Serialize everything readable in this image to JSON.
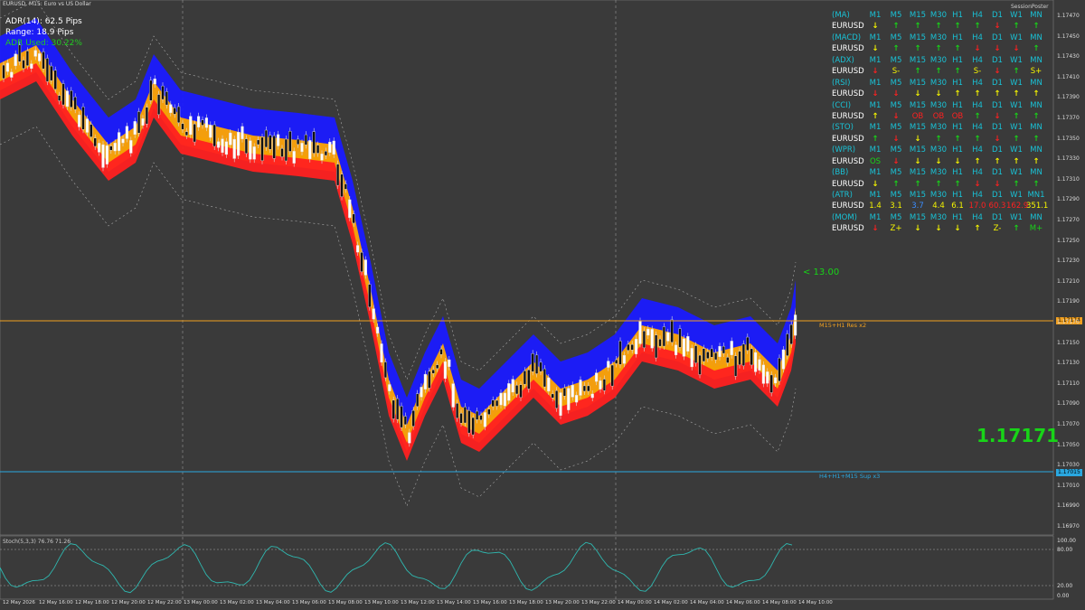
{
  "symbol_bar": "EURUSD, M15: Euro vs US Dollar",
  "session": "SessionPoster",
  "info": {
    "adr": "ADR(14): 62.5 Pips",
    "range": "Range: 18.9 Pips",
    "used": "ADR Used: 30.22%"
  },
  "table": [
    {
      "type": "hdr",
      "label": "(MA)",
      "cells": [
        "M1",
        "M5",
        "M15",
        "M30",
        "H1",
        "H4",
        "D1",
        "W1",
        "MN"
      ]
    },
    {
      "type": "val",
      "label": "EURUSD",
      "cells": [
        [
          "↓",
          "dn-y"
        ],
        [
          "↑",
          "up-g"
        ],
        [
          "↑",
          "up-g"
        ],
        [
          "↑",
          "up-g"
        ],
        [
          "↑",
          "up-g"
        ],
        [
          "↑",
          "up-g"
        ],
        [
          "↓",
          "dn-r"
        ],
        [
          "↑",
          "up-g"
        ],
        [
          "↑",
          "up-g"
        ]
      ]
    },
    {
      "type": "hdr",
      "label": "(MACD)",
      "cells": [
        "M1",
        "M5",
        "M15",
        "M30",
        "H1",
        "H4",
        "D1",
        "W1",
        "MN"
      ]
    },
    {
      "type": "val",
      "label": "EURUSD",
      "cells": [
        [
          "↓",
          "dn-y"
        ],
        [
          "↑",
          "up-g"
        ],
        [
          "↑",
          "up-g"
        ],
        [
          "↑",
          "up-g"
        ],
        [
          "↑",
          "up-g"
        ],
        [
          "↓",
          "dn-r"
        ],
        [
          "↓",
          "dn-r"
        ],
        [
          "↓",
          "dn-r"
        ],
        [
          "↑",
          "up-g"
        ]
      ]
    },
    {
      "type": "hdr",
      "label": "(ADX)",
      "cells": [
        "M1",
        "M5",
        "M15",
        "M30",
        "H1",
        "H4",
        "D1",
        "W1",
        "MN"
      ]
    },
    {
      "type": "val",
      "label": "EURUSD",
      "cells": [
        [
          "↓",
          "dn-r"
        ],
        [
          "S-",
          "txt-y"
        ],
        [
          "↑",
          "up-g"
        ],
        [
          "↑",
          "up-g"
        ],
        [
          "↑",
          "up-g"
        ],
        [
          "S-",
          "txt-y"
        ],
        [
          "↓",
          "dn-r"
        ],
        [
          "↑",
          "up-g"
        ],
        [
          "S+",
          "txt-y"
        ]
      ]
    },
    {
      "type": "hdr",
      "label": "(RSI)",
      "cells": [
        "M1",
        "M5",
        "M15",
        "M30",
        "H1",
        "H4",
        "D1",
        "W1",
        "MN"
      ]
    },
    {
      "type": "val",
      "label": "EURUSD",
      "cells": [
        [
          "↓",
          "dn-r"
        ],
        [
          "↓",
          "dn-r"
        ],
        [
          "↓",
          "dn-y"
        ],
        [
          "↓",
          "dn-y"
        ],
        [
          "↑",
          "up-y"
        ],
        [
          "↑",
          "up-y"
        ],
        [
          "↑",
          "up-y"
        ],
        [
          "↑",
          "up-y"
        ],
        [
          "↑",
          "up-y"
        ]
      ]
    },
    {
      "type": "hdr",
      "label": "(CCI)",
      "cells": [
        "M1",
        "M5",
        "M15",
        "M30",
        "H1",
        "H4",
        "D1",
        "W1",
        "MN"
      ]
    },
    {
      "type": "val",
      "label": "EURUSD",
      "cells": [
        [
          "↑",
          "up-y"
        ],
        [
          "↓",
          "dn-r"
        ],
        [
          "OB",
          "txt-r"
        ],
        [
          "OB",
          "txt-r"
        ],
        [
          "OB",
          "txt-r"
        ],
        [
          "↑",
          "up-g"
        ],
        [
          "↓",
          "dn-r"
        ],
        [
          "↑",
          "up-g"
        ],
        [
          "↑",
          "up-g"
        ]
      ]
    },
    {
      "type": "hdr",
      "label": "(STO)",
      "cells": [
        "M1",
        "M5",
        "M15",
        "M30",
        "H1",
        "H4",
        "D1",
        "W1",
        "MN"
      ]
    },
    {
      "type": "val",
      "label": "EURUSD",
      "cells": [
        [
          "↑",
          "up-g"
        ],
        [
          "↓",
          "dn-r"
        ],
        [
          "↓",
          "dn-y"
        ],
        [
          "↑",
          "up-g"
        ],
        [
          "↑",
          "up-g"
        ],
        [
          "↑",
          "up-g"
        ],
        [
          "↓",
          "dn-r"
        ],
        [
          "↑",
          "up-g"
        ],
        [
          "↑",
          "up-g"
        ]
      ]
    },
    {
      "type": "hdr",
      "label": "(WPR)",
      "cells": [
        "M1",
        "M5",
        "M15",
        "M30",
        "H1",
        "H4",
        "D1",
        "W1",
        "MN"
      ]
    },
    {
      "type": "val",
      "label": "EURUSD",
      "cells": [
        [
          "OS",
          "txt-g"
        ],
        [
          "↓",
          "dn-r"
        ],
        [
          "↓",
          "dn-y"
        ],
        [
          "↓",
          "dn-y"
        ],
        [
          "↓",
          "dn-y"
        ],
        [
          "↑",
          "up-y"
        ],
        [
          "↑",
          "up-y"
        ],
        [
          "↑",
          "up-y"
        ],
        [
          "↑",
          "up-y"
        ]
      ]
    },
    {
      "type": "hdr",
      "label": "(BB)",
      "cells": [
        "M1",
        "M5",
        "M15",
        "M30",
        "H1",
        "H4",
        "D1",
        "W1",
        "MN"
      ]
    },
    {
      "type": "val",
      "label": "EURUSD",
      "cells": [
        [
          "↓",
          "dn-y"
        ],
        [
          "↑",
          "up-g"
        ],
        [
          "↑",
          "up-g"
        ],
        [
          "↑",
          "up-g"
        ],
        [
          "↑",
          "up-g"
        ],
        [
          "↓",
          "dn-r"
        ],
        [
          "↓",
          "dn-r"
        ],
        [
          "↑",
          "up-g"
        ],
        [
          "↑",
          "up-g"
        ]
      ]
    },
    {
      "type": "hdr",
      "label": "(ATR)",
      "cells": [
        "M1",
        "M5",
        "M15",
        "M30",
        "H1",
        "H4",
        "D1",
        "W1",
        "MN1"
      ]
    },
    {
      "type": "val",
      "label": "EURUSD",
      "cells": [
        [
          "1.4",
          "txt-y"
        ],
        [
          "3.1",
          "txt-y"
        ],
        [
          "3.7",
          "txt-b"
        ],
        [
          "4.4",
          "txt-y"
        ],
        [
          "6.1",
          "txt-y"
        ],
        [
          "17.0",
          "txt-r"
        ],
        [
          "60.3",
          "txt-r"
        ],
        [
          "162.9",
          "txt-r"
        ],
        [
          "351.1",
          "txt-y"
        ]
      ]
    },
    {
      "type": "hdr",
      "label": "(MOM)",
      "cells": [
        "M1",
        "M5",
        "M15",
        "M30",
        "H1",
        "H4",
        "D1",
        "W1",
        "MN"
      ]
    },
    {
      "type": "val",
      "label": "EURUSD",
      "cells": [
        [
          "↓",
          "dn-r"
        ],
        [
          "Z+",
          "txt-y"
        ],
        [
          "↓",
          "dn-y"
        ],
        [
          "↓",
          "dn-y"
        ],
        [
          "↓",
          "dn-y"
        ],
        [
          "↑",
          "up-y"
        ],
        [
          "Z-",
          "txt-y"
        ],
        [
          "↑",
          "up-g"
        ],
        [
          "M+",
          "txt-g"
        ]
      ]
    }
  ],
  "current_price": "1.17171",
  "target": "< 13.00",
  "resistance": {
    "label": "M15+H1 Res x2",
    "price": "1.17174",
    "color": "#f0a020"
  },
  "support": {
    "label": "H4+H1+M15 Sup x3",
    "price": "1.17015",
    "color": "#2aa8e0"
  },
  "price_axis": [
    "1.17470",
    "1.17450",
    "1.17430",
    "1.17410",
    "1.17390",
    "1.17370",
    "1.17350",
    "1.17330",
    "1.17310",
    "1.17290",
    "1.17270",
    "1.17250",
    "1.17230",
    "1.17210",
    "1.17190",
    "1.17170",
    "1.17150",
    "1.17130",
    "1.17110",
    "1.17090",
    "1.17070",
    "1.17050",
    "1.17030",
    "1.17010",
    "1.16990",
    "1.16970"
  ],
  "stoch": {
    "label": "Stoch(5,3,3) 76.76 71.26",
    "axis": [
      "100.00",
      "80.00",
      "20.00",
      "0.00"
    ]
  },
  "time_axis": [
    "12 May 2026",
    "12 May 16:00",
    "12 May 18:00",
    "12 May 20:00",
    "12 May 22:00",
    "13 May 00:00",
    "13 May 02:00",
    "13 May 04:00",
    "13 May 06:00",
    "13 May 08:00",
    "13 May 10:00",
    "13 May 12:00",
    "13 May 14:00",
    "13 May 16:00",
    "13 May 18:00",
    "13 May 20:00",
    "13 May 22:00",
    "14 May 00:00",
    "14 May 02:00",
    "14 May 04:00",
    "14 May 06:00",
    "14 May 08:00",
    "14 May 10:00"
  ]
}
